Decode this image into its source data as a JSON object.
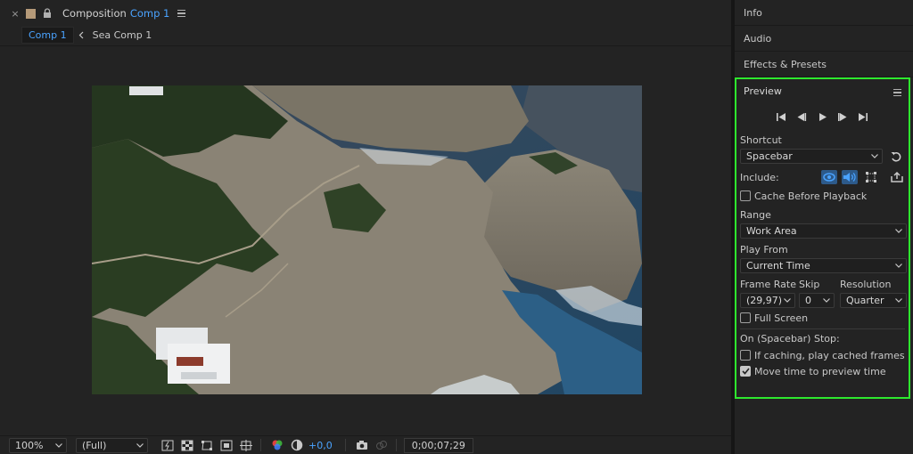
{
  "composition": {
    "close_glyph": "×",
    "title": "Composition",
    "comp_name": "Comp 1",
    "tabs": [
      {
        "label": "Comp 1",
        "active": true
      },
      {
        "label": "Sea Comp 1",
        "active": false
      }
    ],
    "footer": {
      "zoom": "100%",
      "resolution": "(Full)",
      "exposure": "+0,0",
      "timecode": "0;00;07;29"
    }
  },
  "right_panels": {
    "tabs": [
      "Info",
      "Audio",
      "Effects & Presets"
    ]
  },
  "preview": {
    "title": "Preview",
    "shortcut_label": "Shortcut",
    "shortcut_value": "Spacebar",
    "include_label": "Include:",
    "cache_before_playback": {
      "label": "Cache Before Playback",
      "checked": false
    },
    "range_label": "Range",
    "range_value": "Work Area",
    "play_from_label": "Play From",
    "play_from_value": "Current Time",
    "frame_rate_label": "Frame Rate",
    "frame_rate_value": "(29,97)",
    "skip_label": "Skip",
    "skip_value": "0",
    "resolution_label": "Resolution",
    "resolution_value": "Quarter",
    "full_screen": {
      "label": "Full Screen",
      "checked": false
    },
    "stop_label": "On (Spacebar) Stop:",
    "if_caching": {
      "label": "If caching, play cached frames",
      "checked": false
    },
    "move_time": {
      "label": "Move time to preview time",
      "checked": true
    }
  },
  "colors": {
    "accent_blue": "#4aa3ff",
    "highlight_green": "#2ee82e"
  }
}
